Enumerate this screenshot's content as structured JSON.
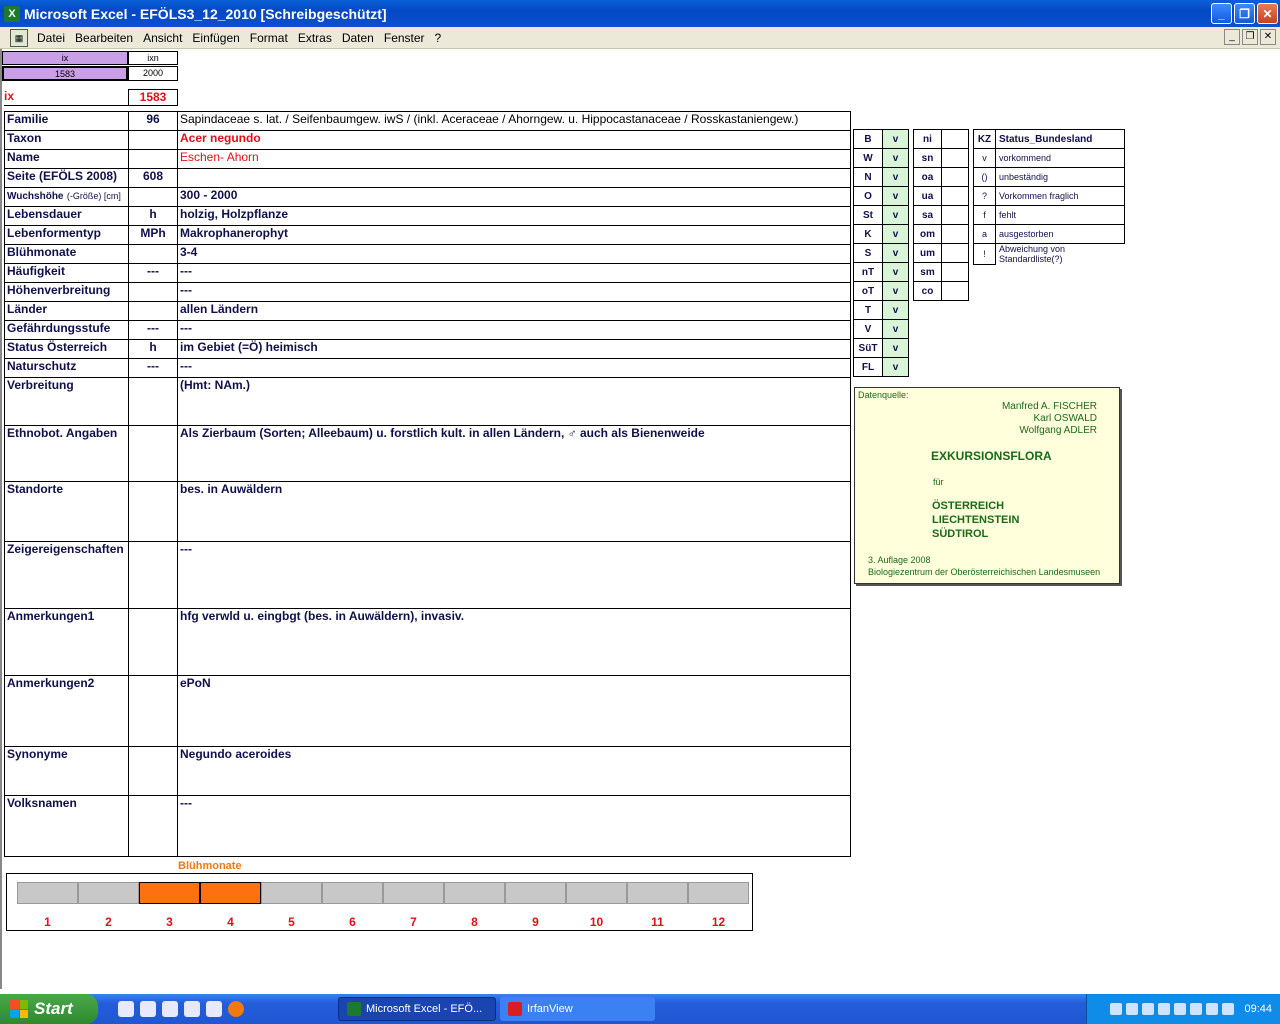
{
  "window": {
    "app_title": "Microsoft Excel - EFÖLS3_12_2010  [Schreibgeschützt]",
    "app_icon": "excel-icon"
  },
  "menu": {
    "items": [
      "Datei",
      "Bearbeiten",
      "Ansicht",
      "Einfügen",
      "Format",
      "Extras",
      "Daten",
      "Fenster",
      "?"
    ]
  },
  "mini": {
    "h1": "ix",
    "h2": "ixn",
    "v1": "1583",
    "v2": "2000",
    "ix_label": "ix",
    "ix_value": "1583"
  },
  "rows": [
    {
      "label": "Familie",
      "code": "96",
      "value": "Sapindaceae s. lat.  /  Seifenbaumgew. iwS / (inkl. Aceraceae / Ahorngew. u. Hippocastanaceae / Rosskastaniengew.)"
    },
    {
      "label": "Taxon",
      "code": "",
      "value": "Acer negundo"
    },
    {
      "label": "Name",
      "code": "",
      "value": "Eschen- Ahorn"
    },
    {
      "label": "Seite (EFÖLS 2008)",
      "code": "608",
      "value": ""
    },
    {
      "label": "Wuchshöhe",
      "label_suffix": "(-Größe) [cm]",
      "code": "",
      "value": " 300 - 2000"
    },
    {
      "label": "Lebensdauer",
      "code": "h",
      "value": "holzig, Holzpflanze"
    },
    {
      "label": "Lebenformentyp",
      "code": "MPh",
      "value": "Makrophanerophyt"
    },
    {
      "label": "Blühmonate",
      "code": "",
      "value": " 3-4"
    },
    {
      "label": "Häufigkeit",
      "code": "---",
      "value": " ---"
    },
    {
      "label": "Höhenverbreitung",
      "code": "",
      "value": " ---"
    },
    {
      "label": "Länder",
      "code": "",
      "value": "allen Ländern"
    },
    {
      "label": "Gefährdungsstufe",
      "code": "---",
      "value": "   ---"
    },
    {
      "label": "Status Österreich",
      "code": "h",
      "value": "im Gebiet (=Ö) heimisch"
    },
    {
      "label": "Naturschutz",
      "code": "---",
      "value": " ---"
    },
    {
      "label": "Verbreitung",
      "code": "",
      "value": "(Hmt: NAm.)"
    },
    {
      "label": "Ethnobot. Angaben",
      "code": "",
      "value": "Als Zierbaum (Sorten; Alleebaum) u. forstlich kult. in allen Ländern, ♂ auch als Bienenweide"
    },
    {
      "label": "Standorte",
      "code": "",
      "value": "bes. in Auwäldern"
    },
    {
      "label": "Zeigereigenschaften",
      "code": "",
      "value": "---"
    },
    {
      "label": "Anmerkungen1",
      "code": "",
      "value": "hfg verwld u. eingbgt (bes. in Auwäldern), invasiv."
    },
    {
      "label": "Anmerkungen2",
      "code": "",
      "value": "ePoN"
    },
    {
      "label": "Synonyme",
      "code": "",
      "value": "Negundo aceroides"
    },
    {
      "label": "Volksnamen",
      "code": "",
      "value": "---"
    }
  ],
  "states": [
    {
      "k": "B",
      "v": "v"
    },
    {
      "k": "W",
      "v": "v"
    },
    {
      "k": "N",
      "v": "v"
    },
    {
      "k": "O",
      "v": "v"
    },
    {
      "k": "St",
      "v": "v"
    },
    {
      "k": "K",
      "v": "v"
    },
    {
      "k": "S",
      "v": "v"
    },
    {
      "k": "nT",
      "v": "v"
    },
    {
      "k": "oT",
      "v": "v"
    },
    {
      "k": "T",
      "v": "v"
    },
    {
      "k": "V",
      "v": "v"
    },
    {
      "k": "SüT",
      "v": "v"
    },
    {
      "k": "FL",
      "v": "v"
    }
  ],
  "regions": [
    {
      "k": "ni",
      "v": ""
    },
    {
      "k": "sn",
      "v": ""
    },
    {
      "k": "oa",
      "v": ""
    },
    {
      "k": "ua",
      "v": ""
    },
    {
      "k": "sa",
      "v": ""
    },
    {
      "k": "om",
      "v": ""
    },
    {
      "k": "um",
      "v": ""
    },
    {
      "k": "sm",
      "v": ""
    },
    {
      "k": "co",
      "v": ""
    }
  ],
  "legend": {
    "header_k": "KZ",
    "header_v": "Status_Bundesland",
    "items": [
      {
        "k": "v",
        "v": "vorkommend"
      },
      {
        "k": "()",
        "v": "unbeständig"
      },
      {
        "k": "?",
        "v": "Vorkommen fraglich"
      },
      {
        "k": "f",
        "v": "fehlt"
      },
      {
        "k": "a",
        "v": "ausgestorben"
      },
      {
        "k": "!",
        "v": "Abweichung von Standardliste(?)"
      }
    ]
  },
  "source": {
    "label": "Datenquelle:",
    "author1": "Manfred A. FISCHER",
    "author2": "Karl OSWALD",
    "author3": "Wolfgang ADLER",
    "book": "EXKURSIONSFLORA",
    "fuer": "für",
    "c1": "ÖSTERREICH",
    "c2": "LIECHTENSTEIN",
    "c3": "SÜDTIROL",
    "edition": "3. Auflage 2008",
    "publisher": "Biologiezentrum der Oberösterreichischen Landesmuseen"
  },
  "chart_data": {
    "type": "bar",
    "title": "Blühmonate",
    "categories": [
      "1",
      "2",
      "3",
      "4",
      "5",
      "6",
      "7",
      "8",
      "9",
      "10",
      "11",
      "12"
    ],
    "values": [
      0,
      0,
      1,
      1,
      0,
      0,
      0,
      0,
      0,
      0,
      0,
      0
    ],
    "active_color": "#ff7010",
    "inactive_color": "#c8c8c8"
  },
  "taskbar": {
    "start_label": "Start",
    "tasks": [
      {
        "label": "Microsoft Excel - EFÖ...",
        "icon": "excel-icon"
      },
      {
        "label": "IrfanView",
        "icon": "irfanview-icon"
      }
    ],
    "clock": "09:44"
  }
}
